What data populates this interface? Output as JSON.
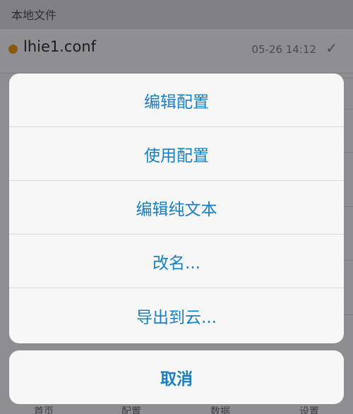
{
  "background": {
    "section_title": "本地文件",
    "file": {
      "name": "lhie1.conf",
      "date": "05-26 14:12",
      "status_color": "#b8780f",
      "check_icon": "checkmark-icon"
    },
    "tabs": [
      {
        "label": "首页"
      },
      {
        "label": "配置"
      },
      {
        "label": "数据"
      },
      {
        "label": "设置"
      }
    ]
  },
  "action_sheet": {
    "items": [
      {
        "label": "编辑配置"
      },
      {
        "label": "使用配置"
      },
      {
        "label": "编辑纯文本"
      },
      {
        "label": "改名..."
      },
      {
        "label": "导出到云..."
      }
    ],
    "cancel_label": "取消",
    "accent_color": "#1a7fc0"
  }
}
